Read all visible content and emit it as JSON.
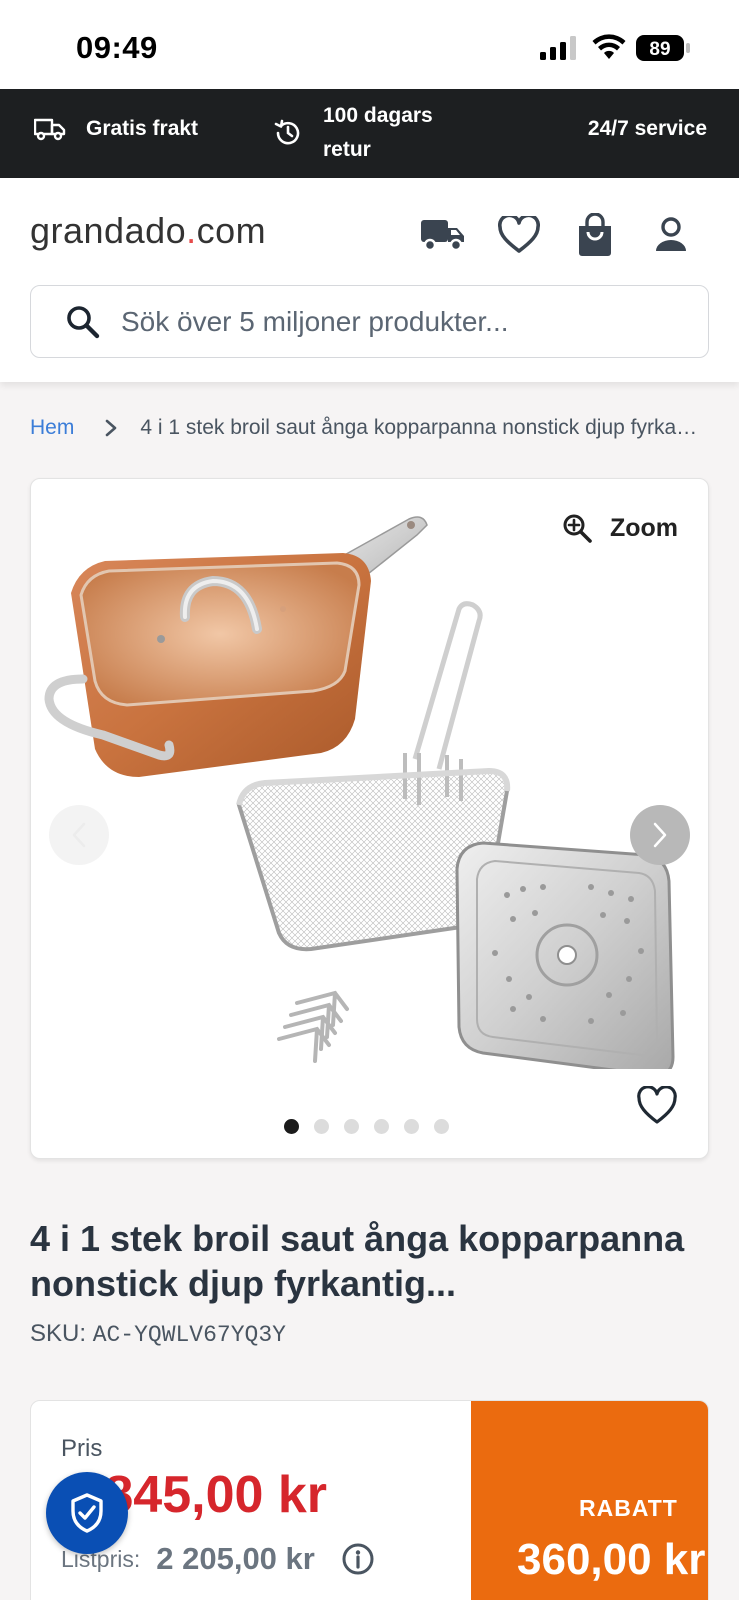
{
  "status_bar": {
    "time": "09:49",
    "battery": "89"
  },
  "promo": {
    "shipping": "Gratis frakt",
    "returns_line1": "100 dagars",
    "returns_line2": "retur",
    "service": "24/7 service"
  },
  "header": {
    "logo_main": "grandado",
    "logo_dot": ".",
    "logo_tld": "com",
    "search_placeholder": "Sök över 5 miljoner produkter..."
  },
  "breadcrumb": {
    "home": "Hem",
    "current": "4 i 1 stek broil saut ånga kopparpanna nonstick djup fyrkantig..."
  },
  "gallery": {
    "zoom_label": "Zoom",
    "image_count": 6,
    "active_index": 0
  },
  "product": {
    "title": "4 i 1 stek broil saut ånga kopparpanna nonstick djup fyrkantig...",
    "sku_label": "SKU:",
    "sku_code": "AC-YQWLV67YQ3Y"
  },
  "pricing": {
    "price_label": "Pris",
    "price": "1 845,00 kr",
    "list_label": "Listpris:",
    "list_price": "2 205,00 kr",
    "discount_label": "RABATT",
    "discount_value": "360,00 kr"
  },
  "colors": {
    "promo_bg": "#1d1f21",
    "price_red": "#d6262c",
    "discount_orange": "#eb6b0f",
    "link_blue": "#3b7dd8",
    "shield_blue": "#0a4fb4"
  }
}
